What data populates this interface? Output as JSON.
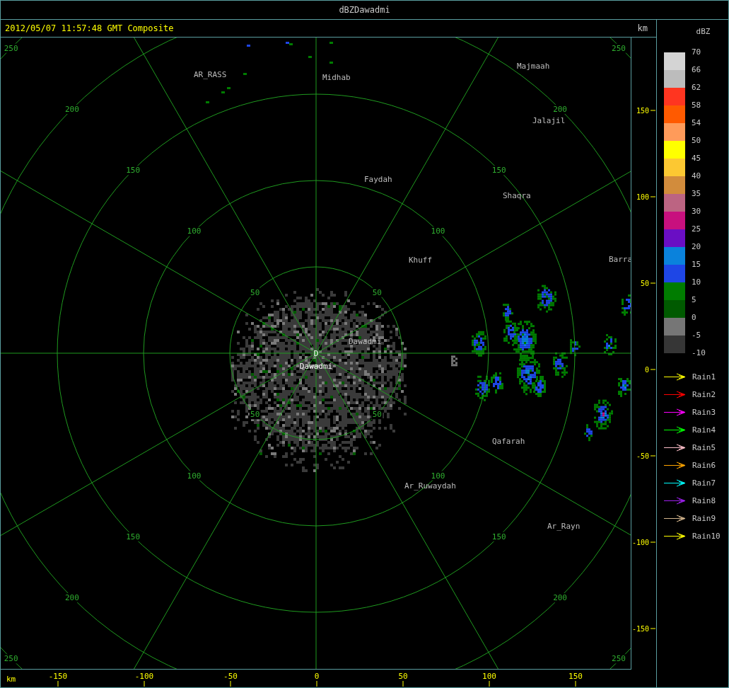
{
  "window": {
    "title": "dBZDawadmi"
  },
  "header": {
    "timestamp": "2012/05/07 11:57:48 GMT Composite",
    "unit": "km"
  },
  "map": {
    "range_rings": [
      {
        "labels": [
          "50",
          "50",
          "50",
          "50"
        ]
      },
      {
        "labels": [
          "100",
          "100",
          "100",
          "100"
        ]
      },
      {
        "labels": [
          "150",
          "150",
          "150",
          "150"
        ]
      },
      {
        "labels": [
          "200",
          "200",
          "200",
          "200"
        ]
      },
      {
        "labels": [
          "250",
          "250",
          "250",
          "250"
        ]
      }
    ],
    "cities": [
      {
        "name": "AR_RASS"
      },
      {
        "name": "Midhab"
      },
      {
        "name": "Majmaah"
      },
      {
        "name": "Jalajil"
      },
      {
        "name": "Faydah"
      },
      {
        "name": "Shaqra"
      },
      {
        "name": "Khuff"
      },
      {
        "name": "Barra"
      },
      {
        "name": "Dawadmi"
      },
      {
        "name": "Qafarah"
      },
      {
        "name": "Ar_Ruwaydah"
      },
      {
        "name": "Ar_Rayn"
      }
    ],
    "site": {
      "marker": "D",
      "name": "Dawadmi"
    }
  },
  "y_axis": {
    "ticks": [
      "150",
      "100",
      "50",
      "0",
      "-50",
      "-100",
      "-150"
    ]
  },
  "x_axis": {
    "unit": "km",
    "ticks": [
      "-150",
      "-100",
      "-50",
      "0",
      "50",
      "100",
      "150"
    ]
  },
  "legend": {
    "title": "dBZ",
    "labels": [
      "70",
      "66",
      "62",
      "58",
      "54",
      "50",
      "45",
      "40",
      "35",
      "30",
      "25",
      "20",
      "15",
      "10",
      "5",
      "0",
      "-5",
      "-10"
    ],
    "swatches": [
      {
        "color": "#d4d4d4"
      },
      {
        "color": "#bcbcbc"
      },
      {
        "color": "#ff3520"
      },
      {
        "color": "#ff5a00"
      },
      {
        "color": "#ff9b5a"
      },
      {
        "color": "#ffff00"
      },
      {
        "color": "#fcc832"
      },
      {
        "color": "#d28c3c"
      },
      {
        "color": "#bc6482"
      },
      {
        "color": "#c8107e"
      },
      {
        "color": "#6a0ec4"
      },
      {
        "color": "#0a82dc"
      },
      {
        "color": "#1e46e6"
      },
      {
        "color": "#007c00"
      },
      {
        "color": "#005a00"
      },
      {
        "color": "#767676"
      },
      {
        "color": "#363636"
      }
    ]
  },
  "tracks": [
    {
      "label": "Rain1",
      "color": "#ffff00"
    },
    {
      "label": "Rain2",
      "color": "#ff0000"
    },
    {
      "label": "Rain3",
      "color": "#ff00ff"
    },
    {
      "label": "Rain4",
      "color": "#00ff00"
    },
    {
      "label": "Rain5",
      "color": "#ffc0cb"
    },
    {
      "label": "Rain6",
      "color": "#ffa500"
    },
    {
      "label": "Rain7",
      "color": "#00ffff"
    },
    {
      "label": "Rain8",
      "color": "#a020f0"
    },
    {
      "label": "Rain9",
      "color": "#d2b48c"
    },
    {
      "label": "Rain10",
      "color": "#ffff00"
    }
  ]
}
